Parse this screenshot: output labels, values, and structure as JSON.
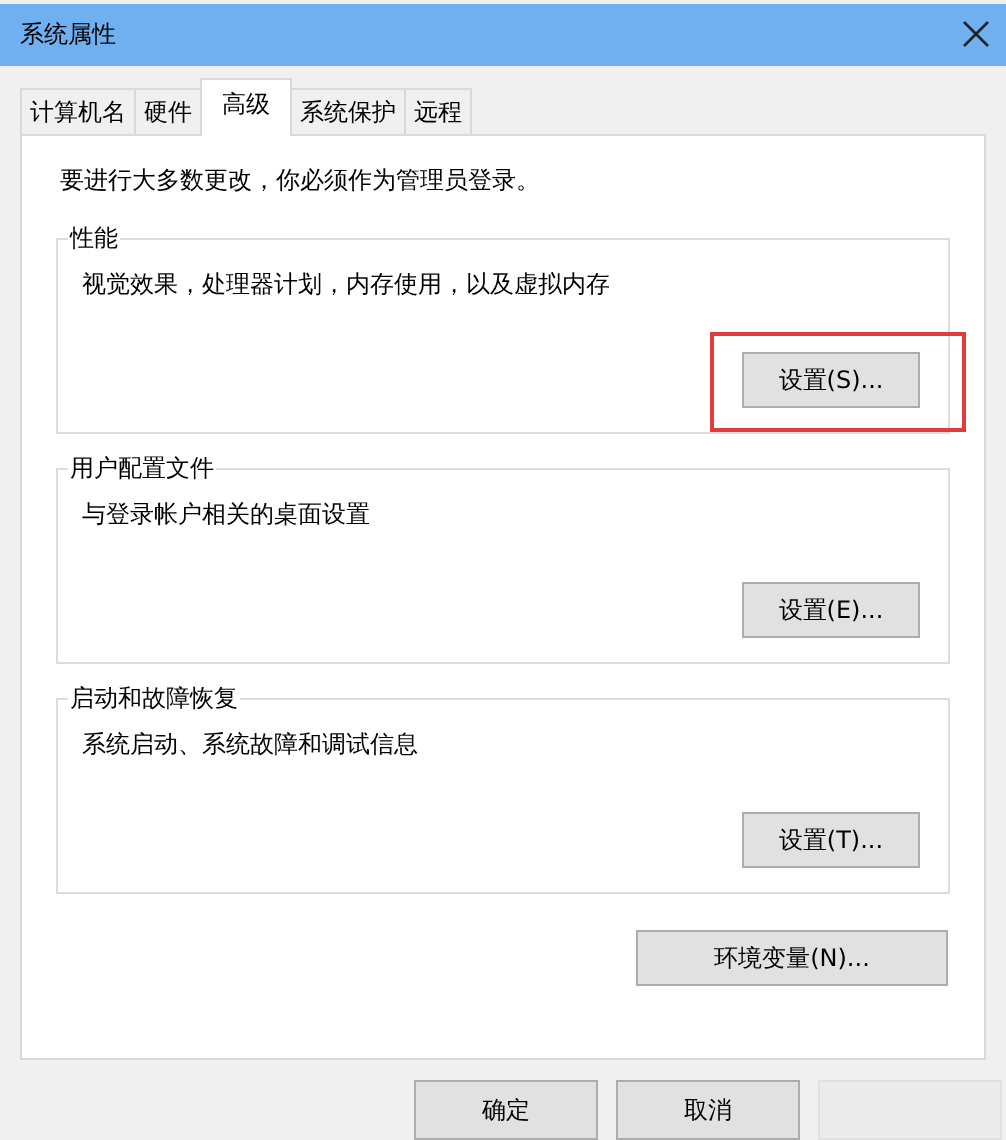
{
  "window": {
    "title": "系统属性"
  },
  "tabs": [
    {
      "label": "计算机名",
      "selected": false
    },
    {
      "label": "硬件",
      "selected": false
    },
    {
      "label": "高级",
      "selected": true
    },
    {
      "label": "系统保护",
      "selected": false
    },
    {
      "label": "远程",
      "selected": false
    }
  ],
  "panel": {
    "notice": "要进行大多数更改，你必须作为管理员登录。",
    "groups": [
      {
        "title": "性能",
        "description": "视觉效果，处理器计划，内存使用，以及虚拟内存",
        "button": "设置(S)...",
        "highlighted": true
      },
      {
        "title": "用户配置文件",
        "description": "与登录帐户相关的桌面设置",
        "button": "设置(E)...",
        "highlighted": false
      },
      {
        "title": "启动和故障恢复",
        "description": "系统启动、系统故障和调试信息",
        "button": "设置(T)...",
        "highlighted": false
      }
    ],
    "env_button": "环境变量(N)..."
  },
  "buttons": [
    {
      "label": "确定",
      "disabled": false
    },
    {
      "label": "取消",
      "disabled": false
    },
    {
      "disabled": true
    }
  ]
}
